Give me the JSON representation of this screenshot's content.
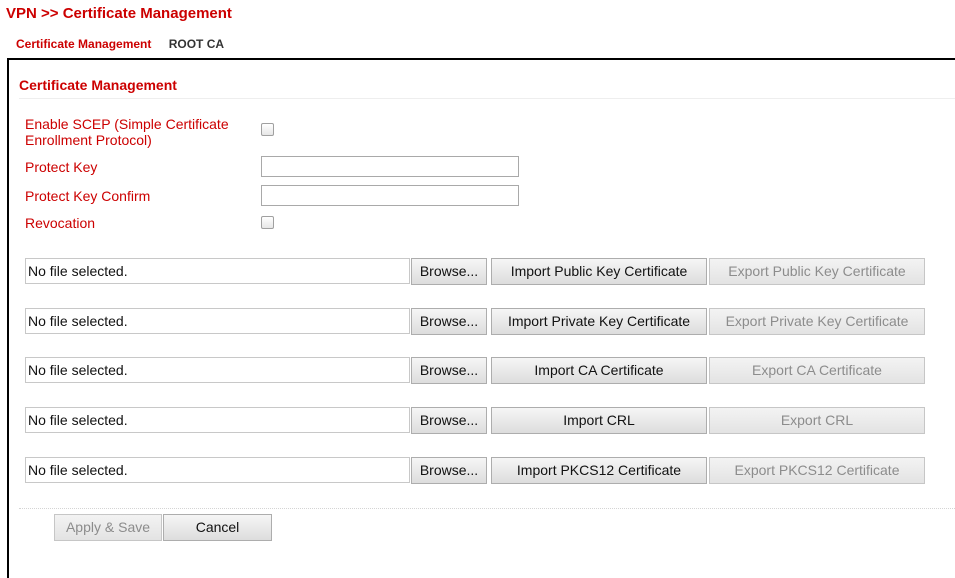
{
  "header": {
    "breadcrumb": "VPN >> Certificate Management"
  },
  "tabs": [
    {
      "label": "Certificate Management",
      "active": true
    },
    {
      "label": "ROOT CA",
      "active": false
    }
  ],
  "panel": {
    "title": "Certificate Management"
  },
  "form": {
    "enable_scep": {
      "label": "Enable SCEP (Simple Certificate Enrollment Protocol)",
      "checked": false
    },
    "protect_key": {
      "label": "Protect Key",
      "value": ""
    },
    "protect_key_confirm": {
      "label": "Protect Key Confirm",
      "value": ""
    },
    "revocation": {
      "label": "Revocation",
      "checked": false
    }
  },
  "file_rows": [
    {
      "file_text": "No file selected.",
      "browse_label": "Browse...",
      "import_label": "Import Public Key Certificate",
      "export_label": "Export Public Key Certificate",
      "export_enabled": false
    },
    {
      "file_text": "No file selected.",
      "browse_label": "Browse...",
      "import_label": "Import Private Key Certificate",
      "export_label": "Export Private Key Certificate",
      "export_enabled": false
    },
    {
      "file_text": "No file selected.",
      "browse_label": "Browse...",
      "import_label": "Import CA Certificate",
      "export_label": "Export CA Certificate",
      "export_enabled": false
    },
    {
      "file_text": "No file selected.",
      "browse_label": "Browse...",
      "import_label": "Import CRL",
      "export_label": "Export CRL",
      "export_enabled": false
    },
    {
      "file_text": "No file selected.",
      "browse_label": "Browse...",
      "import_label": "Import PKCS12 Certificate",
      "export_label": "Export PKCS12 Certificate",
      "export_enabled": false
    }
  ],
  "footer": {
    "apply_save_label": "Apply & Save",
    "apply_save_enabled": false,
    "cancel_label": "Cancel"
  },
  "colors": {
    "accent": "#cc0000",
    "disabled_text": "#8c8c8c"
  }
}
